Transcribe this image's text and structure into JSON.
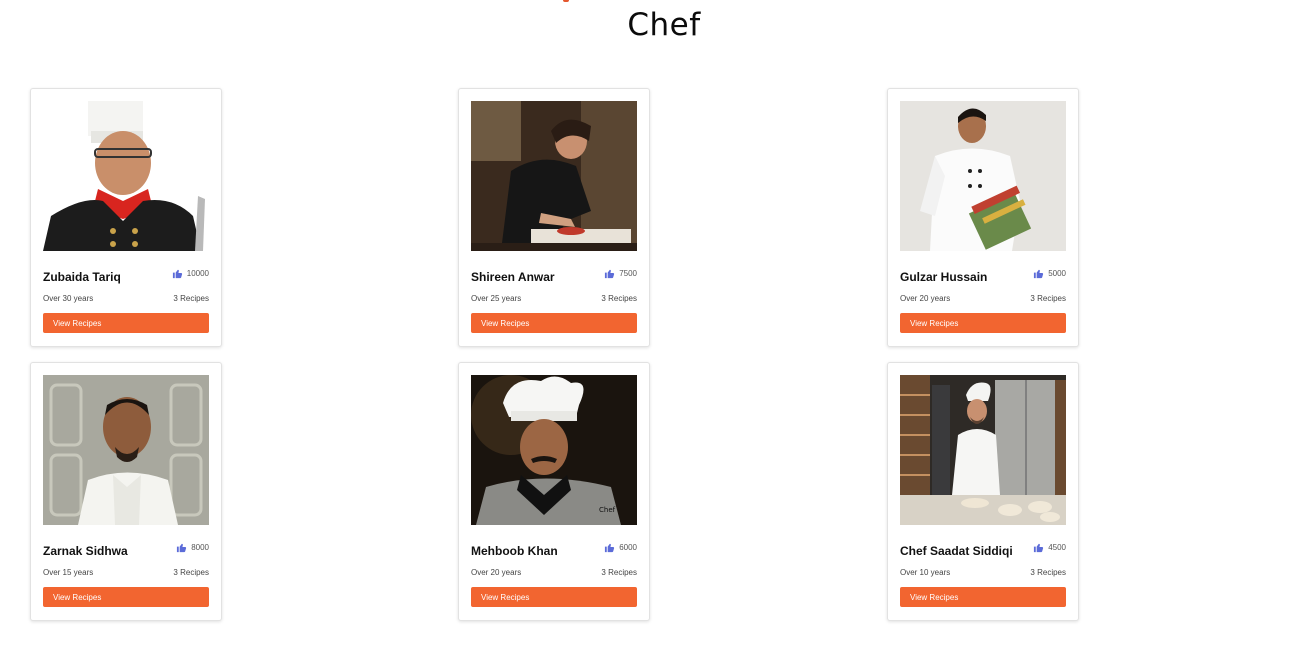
{
  "page": {
    "title": "Chef"
  },
  "chefs": [
    {
      "name": "Zubaida Tariq",
      "likes": "10000",
      "experience": "Over 30 years",
      "recipes": "3 Recipes",
      "button": "View Recipes"
    },
    {
      "name": "Shireen Anwar",
      "likes": "7500",
      "experience": "Over 25 years",
      "recipes": "3 Recipes",
      "button": "View Recipes"
    },
    {
      "name": "Gulzar Hussain",
      "likes": "5000",
      "experience": "Over 20 years",
      "recipes": "3 Recipes",
      "button": "View Recipes"
    },
    {
      "name": "Zarnak Sidhwa",
      "likes": "8000",
      "experience": "Over 15 years",
      "recipes": "3 Recipes",
      "button": "View Recipes"
    },
    {
      "name": "Mehboob Khan",
      "likes": "6000",
      "experience": "Over 20 years",
      "recipes": "3 Recipes",
      "button": "View Recipes"
    },
    {
      "name": "Chef Saadat Siddiqi",
      "likes": "4500",
      "experience": "Over 10 years",
      "recipes": "3 Recipes",
      "button": "View Recipes"
    }
  ],
  "colors": {
    "accent": "#f26530",
    "like_icon": "#5b6bd8"
  },
  "icons": {
    "like": "thumbs-up-icon"
  }
}
